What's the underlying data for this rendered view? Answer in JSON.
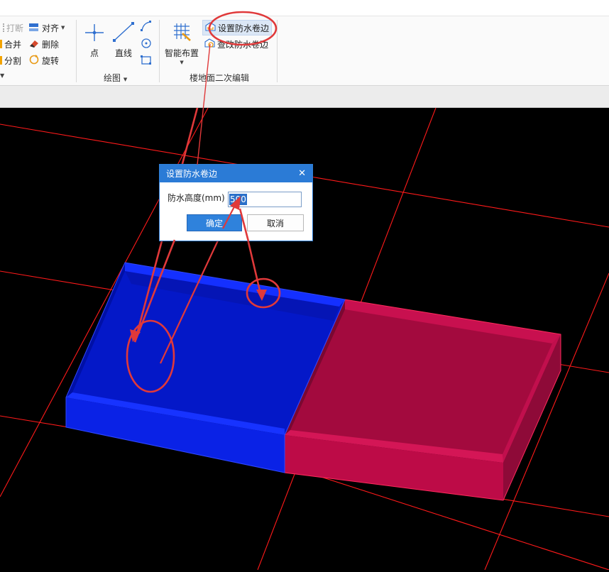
{
  "ribbon": {
    "edit": {
      "break": "打断",
      "merge": "合并",
      "split": "分割",
      "align": "对齐",
      "delete": "删除",
      "rotate": "旋转"
    },
    "draw": {
      "point": "点",
      "line": "直线",
      "group_label": "绘图"
    },
    "floor": {
      "smart_layout": "智能布置",
      "set_waterproof_edge": "设置防水卷边",
      "view_waterproof_edge": "查改防水卷边",
      "group_label": "楼地面二次编辑"
    }
  },
  "dialog": {
    "title": "设置防水卷边",
    "height_label": "防水高度(mm)",
    "height_value": "500",
    "ok": "确定",
    "cancel": "取消"
  },
  "colors": {
    "slab_left": "#0a22e6",
    "slab_right": "#b80b45",
    "grid_line": "#ff1a1a",
    "annotation": "#e0393a",
    "dialog_title": "#2b7bd6"
  }
}
